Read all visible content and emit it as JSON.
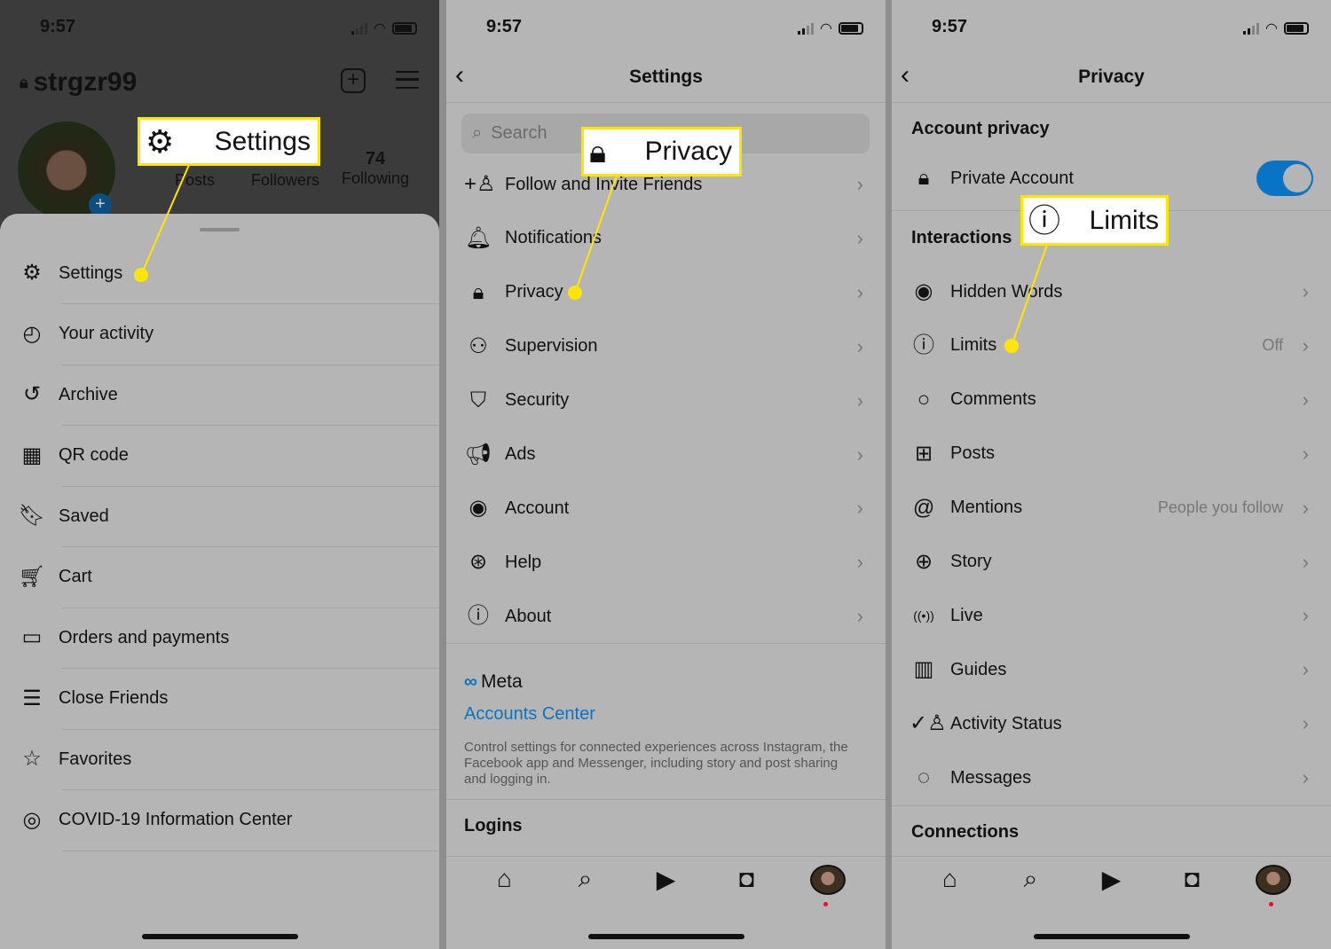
{
  "status_time": "9:57",
  "panel1": {
    "username": "strgzr99",
    "stats": [
      {
        "label": "Posts",
        "value": ""
      },
      {
        "label": "Followers",
        "value": ""
      },
      {
        "label": "Following",
        "value": "74"
      }
    ],
    "menu": [
      {
        "label": "Settings",
        "icon": "gear-icon"
      },
      {
        "label": "Your activity",
        "icon": "activity-icon"
      },
      {
        "label": "Archive",
        "icon": "archive-icon"
      },
      {
        "label": "QR code",
        "icon": "qr-code-icon"
      },
      {
        "label": "Saved",
        "icon": "bookmark-icon"
      },
      {
        "label": "Cart",
        "icon": "cart-icon"
      },
      {
        "label": "Orders and payments",
        "icon": "card-icon"
      },
      {
        "label": "Close Friends",
        "icon": "list-star-icon"
      },
      {
        "label": "Favorites",
        "icon": "star-icon"
      },
      {
        "label": "COVID-19 Information Center",
        "icon": "covid-info-icon"
      }
    ],
    "callout": "Settings"
  },
  "panel2": {
    "title": "Settings",
    "search_placeholder": "Search",
    "items": [
      {
        "label": "Follow and Invite Friends",
        "icon": "add-person-icon"
      },
      {
        "label": "Notifications",
        "icon": "bell-icon"
      },
      {
        "label": "Privacy",
        "icon": "lock-icon"
      },
      {
        "label": "Supervision",
        "icon": "people-icon"
      },
      {
        "label": "Security",
        "icon": "shield-icon"
      },
      {
        "label": "Ads",
        "icon": "megaphone-icon"
      },
      {
        "label": "Account",
        "icon": "account-icon"
      },
      {
        "label": "Help",
        "icon": "lifebuoy-icon"
      },
      {
        "label": "About",
        "icon": "info-icon"
      }
    ],
    "meta_logo": "Meta",
    "accounts_center": "Accounts Center",
    "accounts_desc": "Control settings for connected experiences across Instagram, the Facebook app and Messenger, including story and post sharing and logging in.",
    "logins": "Logins",
    "callout": "Privacy"
  },
  "panel3": {
    "title": "Privacy",
    "account_privacy": "Account privacy",
    "private_account": "Private Account",
    "private_account_on": true,
    "interactions": "Interactions",
    "items": [
      {
        "label": "Hidden Words",
        "icon": "eye-icon",
        "value": ""
      },
      {
        "label": "Limits",
        "icon": "alert-bubble-icon",
        "value": "Off"
      },
      {
        "label": "Comments",
        "icon": "comment-icon",
        "value": ""
      },
      {
        "label": "Posts",
        "icon": "plus-square-icon",
        "value": ""
      },
      {
        "label": "Mentions",
        "icon": "at-icon",
        "value": "People you follow"
      },
      {
        "label": "Story",
        "icon": "story-icon",
        "value": ""
      },
      {
        "label": "Live",
        "icon": "live-icon",
        "value": ""
      },
      {
        "label": "Guides",
        "icon": "guides-icon",
        "value": ""
      },
      {
        "label": "Activity Status",
        "icon": "activity-status-icon",
        "value": ""
      },
      {
        "label": "Messages",
        "icon": "messenger-icon",
        "value": ""
      }
    ],
    "connections": "Connections",
    "callout": "Limits"
  },
  "colors": {
    "accent": "#0a74c4",
    "highlight": "#ffe600",
    "background": "#b5b5b5"
  }
}
